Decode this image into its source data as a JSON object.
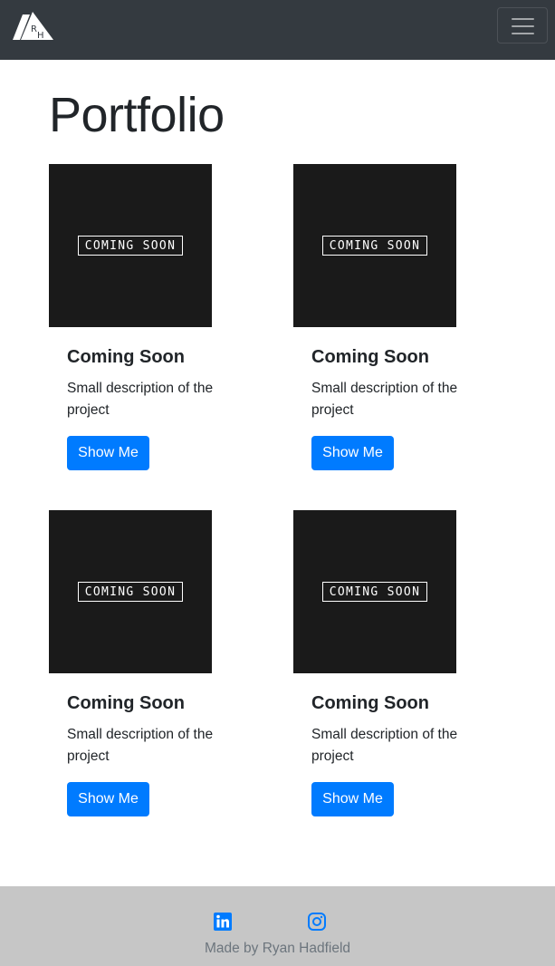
{
  "navbar": {
    "logo_letters": [
      "R",
      "H"
    ],
    "menu_icon": "hamburger-icon"
  },
  "main": {
    "title": "Portfolio",
    "projects": [
      {
        "image_label": "COMING SOON",
        "title": "Coming Soon",
        "description": "Small description of the project",
        "button_label": "Show Me"
      },
      {
        "image_label": "COMING SOON",
        "title": "Coming Soon",
        "description": "Small description of the project",
        "button_label": "Show Me"
      },
      {
        "image_label": "COMING SOON",
        "title": "Coming Soon",
        "description": "Small description of the project",
        "button_label": "Show Me"
      },
      {
        "image_label": "COMING SOON",
        "title": "Coming Soon",
        "description": "Small description of the project",
        "button_label": "Show Me"
      }
    ]
  },
  "footer": {
    "social_links": [
      {
        "icon": "linkedin-icon"
      },
      {
        "icon": "instagram-icon"
      }
    ],
    "credit": "Made by Ryan Hadfield"
  },
  "colors": {
    "navbar_bg": "#343a40",
    "button_bg": "#007bff",
    "social_icon": "#007bff",
    "footer_bg": "#c6c6c6",
    "footer_text": "#6c757d",
    "image_bg": "#1a1a1a"
  }
}
